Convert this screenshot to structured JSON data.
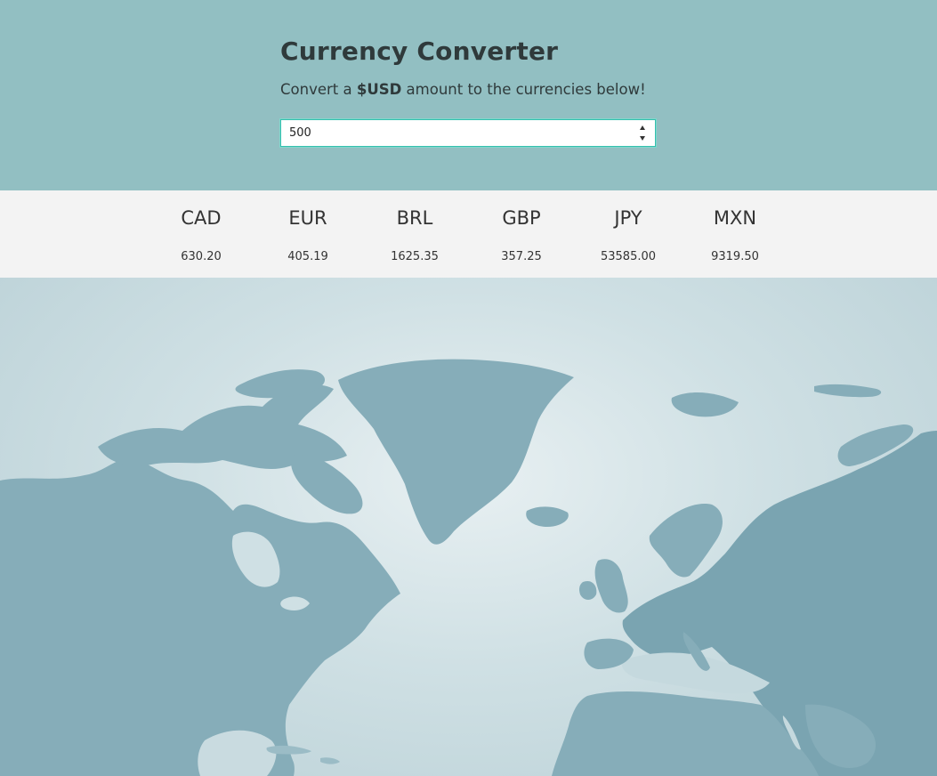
{
  "header": {
    "title": "Currency Converter",
    "subtitle_prefix": "Convert a ",
    "subtitle_bold": "$USD",
    "subtitle_suffix": " amount to the currencies below!"
  },
  "amount_input": {
    "value": "500"
  },
  "rates": [
    {
      "code": "CAD",
      "value": "630.20"
    },
    {
      "code": "EUR",
      "value": "405.19"
    },
    {
      "code": "BRL",
      "value": "1625.35"
    },
    {
      "code": "GBP",
      "value": "357.25"
    },
    {
      "code": "JPY",
      "value": "53585.00"
    },
    {
      "code": "MXN",
      "value": "9319.50"
    }
  ],
  "colors": {
    "header_bg": "#92bfc2",
    "rates_bg": "#f3f3f3",
    "input_border": "#35bfae",
    "map_land": "#86adb9"
  },
  "background_image": "world-map"
}
